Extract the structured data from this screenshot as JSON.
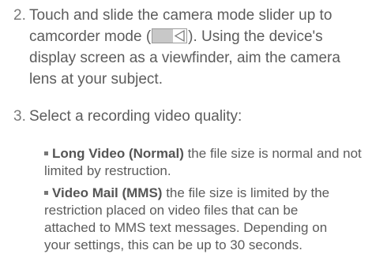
{
  "steps": [
    {
      "number": "2.",
      "line1_before_icon": "Touch and slide the camera mode slider up to",
      "line2_prefix": "camcorder mode (",
      "line2_suffix": "). Using the device's",
      "line3": "display screen as a viewfinder, aim the camera",
      "line4": "lens at your subject."
    },
    {
      "number": "3.",
      "line1": "Select a recording video quality:"
    }
  ],
  "bullets": [
    {
      "label": "Long Video (Normal)",
      "line1_rest": " the file size is normal and not",
      "line2": "limited by restruction."
    },
    {
      "label": "Video Mail (MMS)",
      "line1_rest": " the file size is limited by the",
      "line2": "restriction placed on video files that can be",
      "line3": "attached to MMS text messages. Depending on",
      "line4": "your settings, this can be up to 30 seconds."
    }
  ],
  "icons": {
    "camcorder_mode": "camcorder-mode-slider-icon"
  }
}
